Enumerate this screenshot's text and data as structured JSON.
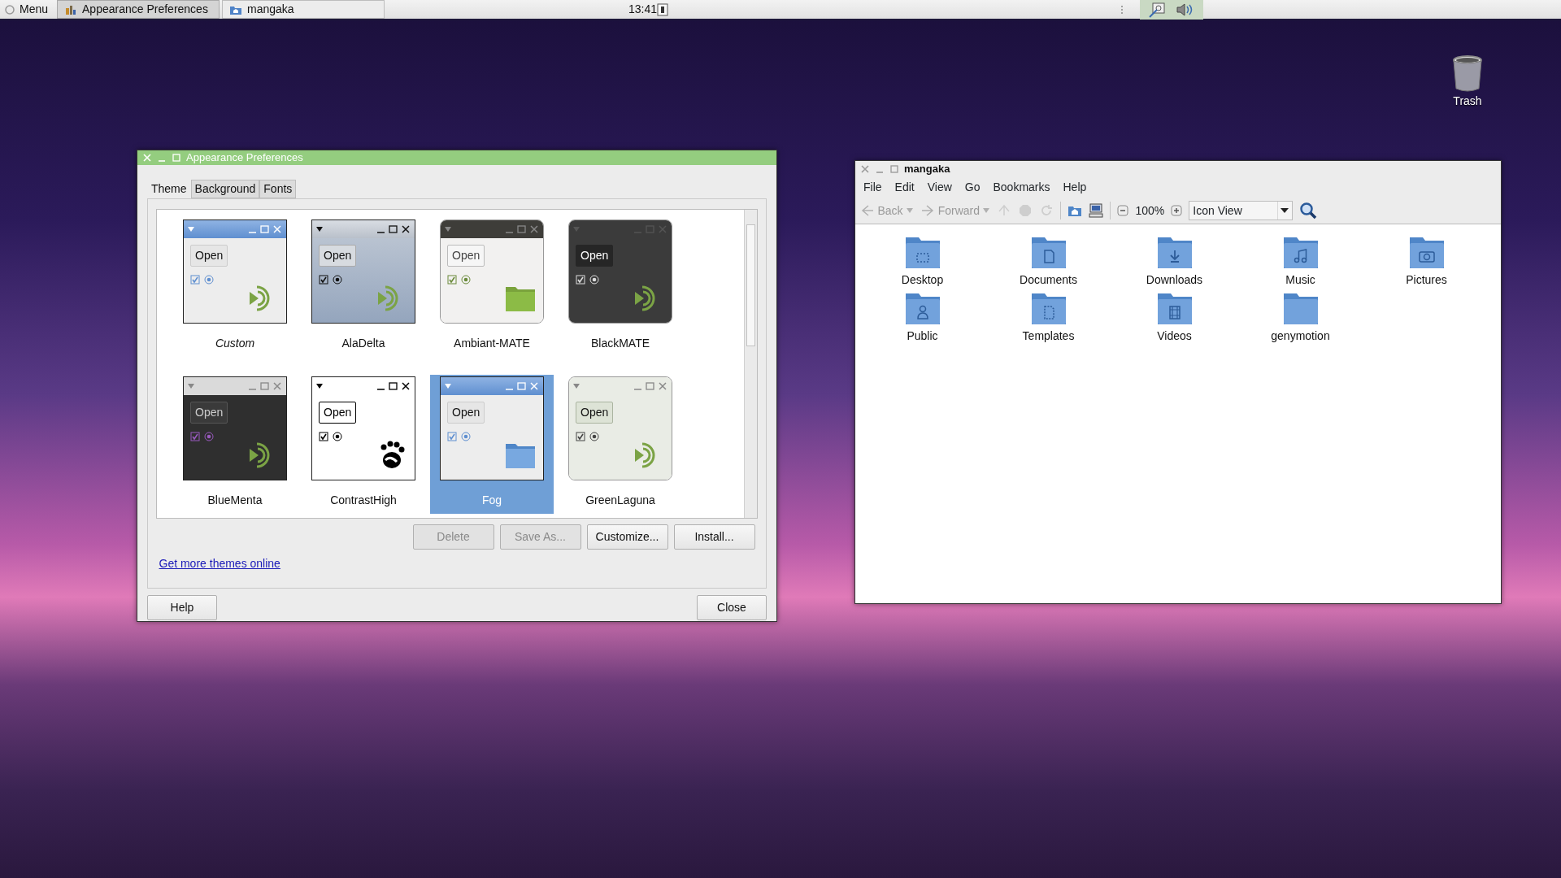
{
  "panel": {
    "menu": "Menu",
    "tasks": [
      {
        "label": "Appearance Preferences",
        "kind": "appearance",
        "selected": true
      },
      {
        "label": "mangaka",
        "kind": "folder",
        "selected": false
      }
    ],
    "clock": "13:41"
  },
  "desktop_icons": [
    {
      "label": "Trash"
    }
  ],
  "appearance_window": {
    "title": "Appearance Preferences",
    "active": true,
    "tabs": [
      {
        "label": "Theme",
        "selected": true
      },
      {
        "label": "Background",
        "selected": false
      },
      {
        "label": "Fonts",
        "selected": false
      }
    ],
    "themes": [
      {
        "name": "Custom",
        "kind": "custom",
        "custom": true,
        "preview_button": "Open",
        "selected": false
      },
      {
        "name": "AlaDelta",
        "kind": "aladelta",
        "custom": false,
        "preview_button": "Open",
        "selected": false
      },
      {
        "name": "Ambiant-MATE",
        "kind": "ambiant",
        "custom": false,
        "preview_button": "Open",
        "selected": false
      },
      {
        "name": "BlackMATE",
        "kind": "blackmate",
        "custom": false,
        "preview_button": "Open",
        "selected": false
      },
      {
        "name": "BlueMenta",
        "kind": "bluementa",
        "custom": false,
        "preview_button": "Open",
        "selected": false
      },
      {
        "name": "ContrastHigh",
        "kind": "contrast",
        "custom": false,
        "preview_button": "Open",
        "selected": false
      },
      {
        "name": "Fog",
        "kind": "fog",
        "custom": false,
        "preview_button": "Open",
        "selected": true
      },
      {
        "name": "GreenLaguna",
        "kind": "greenlaguna",
        "custom": false,
        "preview_button": "Open",
        "selected": false
      }
    ],
    "buttons": [
      {
        "label": "Delete",
        "disabled": true
      },
      {
        "label": "Save As...",
        "disabled": true
      },
      {
        "label": "Customize...",
        "disabled": false
      },
      {
        "label": "Install...",
        "disabled": false
      }
    ],
    "link": "Get more themes online",
    "footer_buttons": [
      {
        "label": "Help"
      },
      {
        "label": "Close"
      }
    ]
  },
  "file_manager": {
    "title": "mangaka",
    "active": false,
    "menu": [
      "File",
      "Edit",
      "View",
      "Go",
      "Bookmarks",
      "Help"
    ],
    "toolbar": [
      {
        "kind": "back",
        "label": "Back",
        "disabled": true
      },
      {
        "kind": "forward",
        "label": "Forward",
        "disabled": true
      },
      {
        "kind": "up",
        "disabled": true
      },
      {
        "kind": "stop",
        "disabled": true
      },
      {
        "kind": "reload",
        "disabled": true
      },
      {
        "kind": "home",
        "disabled": false
      },
      {
        "kind": "computer",
        "disabled": false
      }
    ],
    "zoom": "100%",
    "view": "Icon View",
    "folders": [
      {
        "label": "Desktop",
        "kind": "desktop"
      },
      {
        "label": "Documents",
        "kind": "documents"
      },
      {
        "label": "Downloads",
        "kind": "downloads"
      },
      {
        "label": "Music",
        "kind": "music"
      },
      {
        "label": "Pictures",
        "kind": "pictures"
      },
      {
        "label": "Public",
        "kind": "public"
      },
      {
        "label": "Templates",
        "kind": "templates"
      },
      {
        "label": "Videos",
        "kind": "videos"
      },
      {
        "label": "genymotion",
        "kind": "plain"
      }
    ]
  }
}
